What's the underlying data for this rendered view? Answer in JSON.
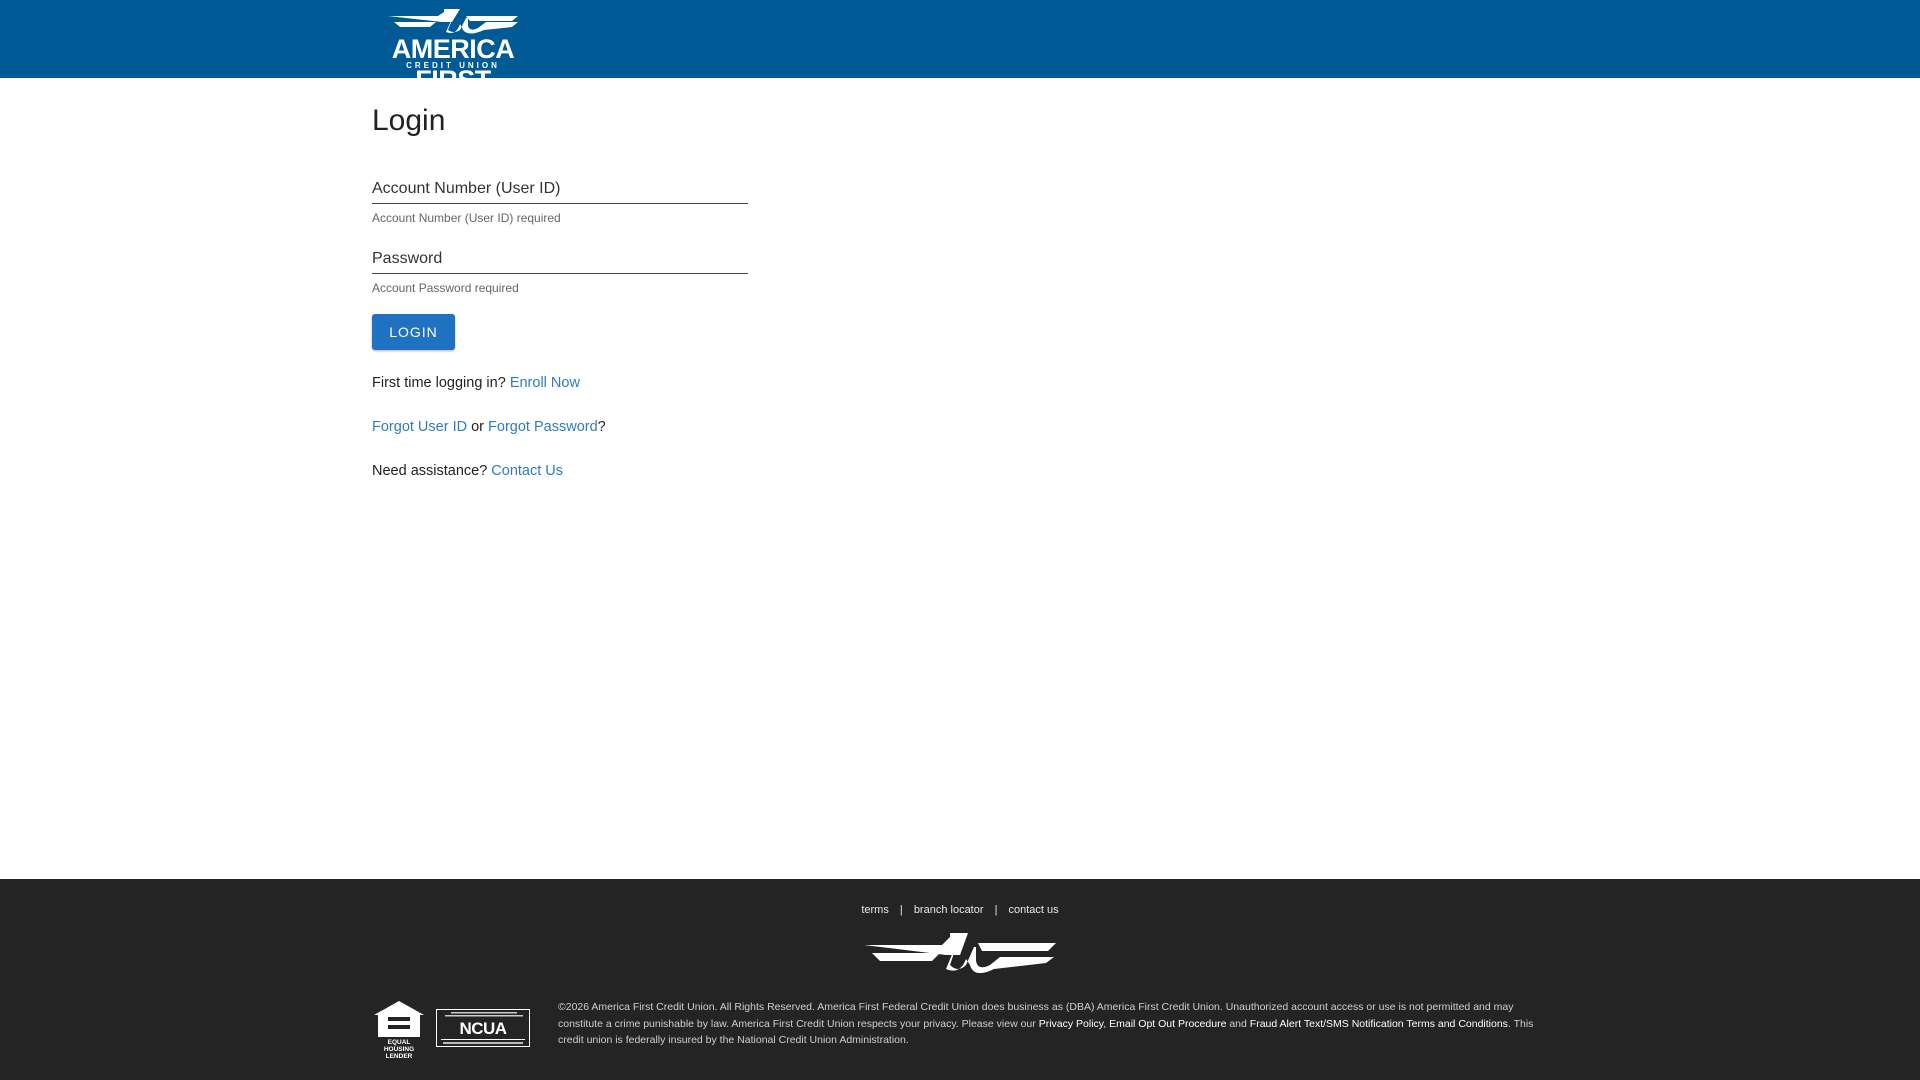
{
  "header": {
    "logo_text": "AMERICA FIRST",
    "logo_subtext": "CREDIT UNION",
    "background": "#005a96"
  },
  "main": {
    "title": "Login",
    "account_field": {
      "placeholder": "Account Number (User ID)",
      "hint": "Account Number (User ID) required"
    },
    "password_field": {
      "placeholder": "Password",
      "hint": "Account Password required"
    },
    "login_button": "LOGIN",
    "enroll": {
      "prefix": "First time logging in? ",
      "link": "Enroll Now"
    },
    "forgot": {
      "user_link": "Forgot User ID",
      "middle": " or ",
      "password_link": "Forgot Password",
      "suffix": "?"
    },
    "assist": {
      "prefix": "Need assistance? ",
      "link": "Contact Us"
    }
  },
  "footer": {
    "links": [
      "terms",
      "branch locator",
      "contact us"
    ],
    "separator": "|",
    "equal_housing": "EQUAL HOUSING LENDER",
    "ncua": "NCUA",
    "legal_1": "©2026 America First Credit Union. All Rights Reserved. America First Federal Credit Union does business as (DBA) America First Credit Union. Unauthorized account access or use is not permitted and may constitute a crime punishable by law. America First Credit Union respects your privacy. Please view our ",
    "privacy_link": "Privacy Policy",
    "comma": ", ",
    "email_link": "Email Opt Out Procedure",
    "and_text": " and ",
    "fraud_link": "Fraud Alert Text/SMS Notification Terms and Conditions",
    "legal_2": ". This credit union is federally insured by the National Credit Union Administration."
  },
  "colors": {
    "accent": "#1f72c2",
    "link": "#2f7cc0",
    "footer_bg": "#242424"
  }
}
